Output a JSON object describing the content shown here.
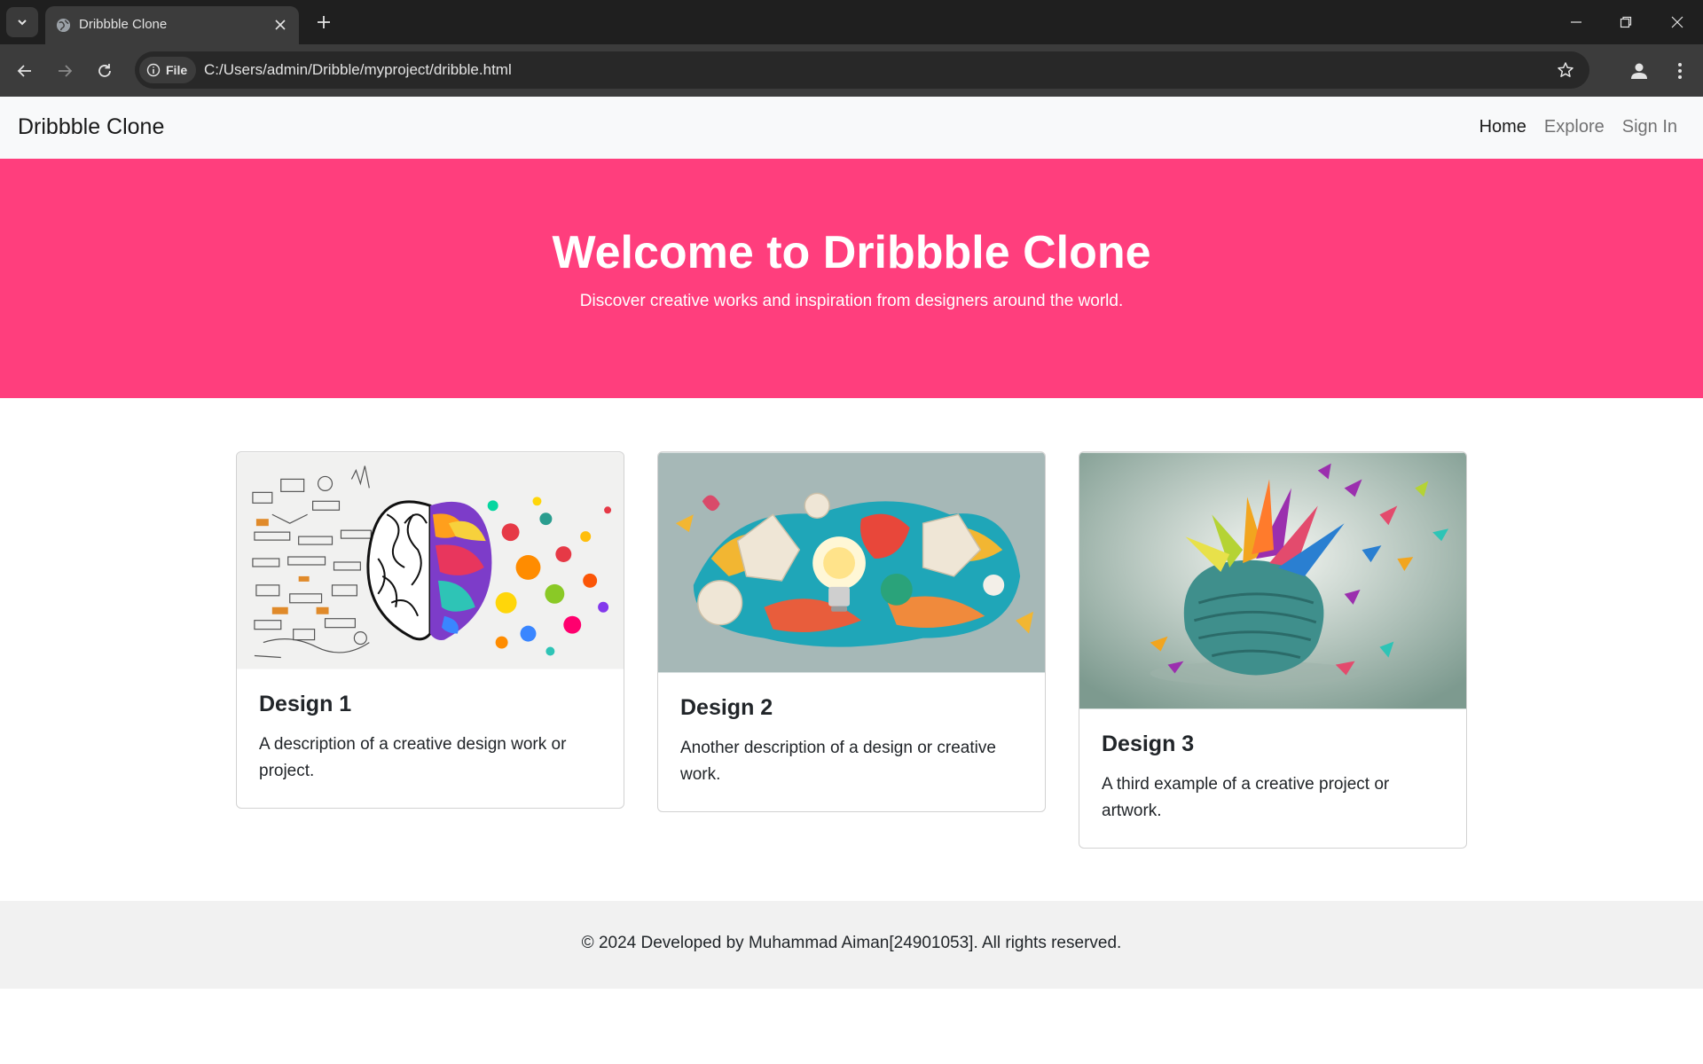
{
  "browser": {
    "tab_title": "Dribbble Clone",
    "file_chip": "File",
    "url": "C:/Users/admin/Dribble/myproject/dribble.html",
    "icons": [
      "tab-search-icon",
      "globe-icon",
      "close-icon",
      "plus-icon",
      "minimize-icon",
      "restore-icon",
      "close-window-icon",
      "back-icon",
      "forward-icon",
      "reload-icon",
      "info-icon",
      "star-icon",
      "profile-icon",
      "more-vert-icon"
    ]
  },
  "navbar": {
    "brand": "Dribbble Clone",
    "links": [
      {
        "label": "Home",
        "active": true
      },
      {
        "label": "Explore",
        "active": false
      },
      {
        "label": "Sign In",
        "active": false
      }
    ]
  },
  "hero": {
    "title": "Welcome to Dribbble Clone",
    "subtitle": "Discover creative works and inspiration from designers around the world.",
    "background_color": "#ff3e7d"
  },
  "cards": [
    {
      "title": "Design 1",
      "text": "A description of a creative design work or project.",
      "image": "brain-doodle-illustration"
    },
    {
      "title": "Design 2",
      "text": "Another description of a design or creative work.",
      "image": "paper-art-lightbulb-illustration"
    },
    {
      "title": "Design 3",
      "text": "A third example of a creative project or artwork.",
      "image": "abstract-sculpture-splash-illustration"
    }
  ],
  "footer": {
    "text": "© 2024 Developed by Muhammad Aiman[24901053]. All rights reserved."
  }
}
